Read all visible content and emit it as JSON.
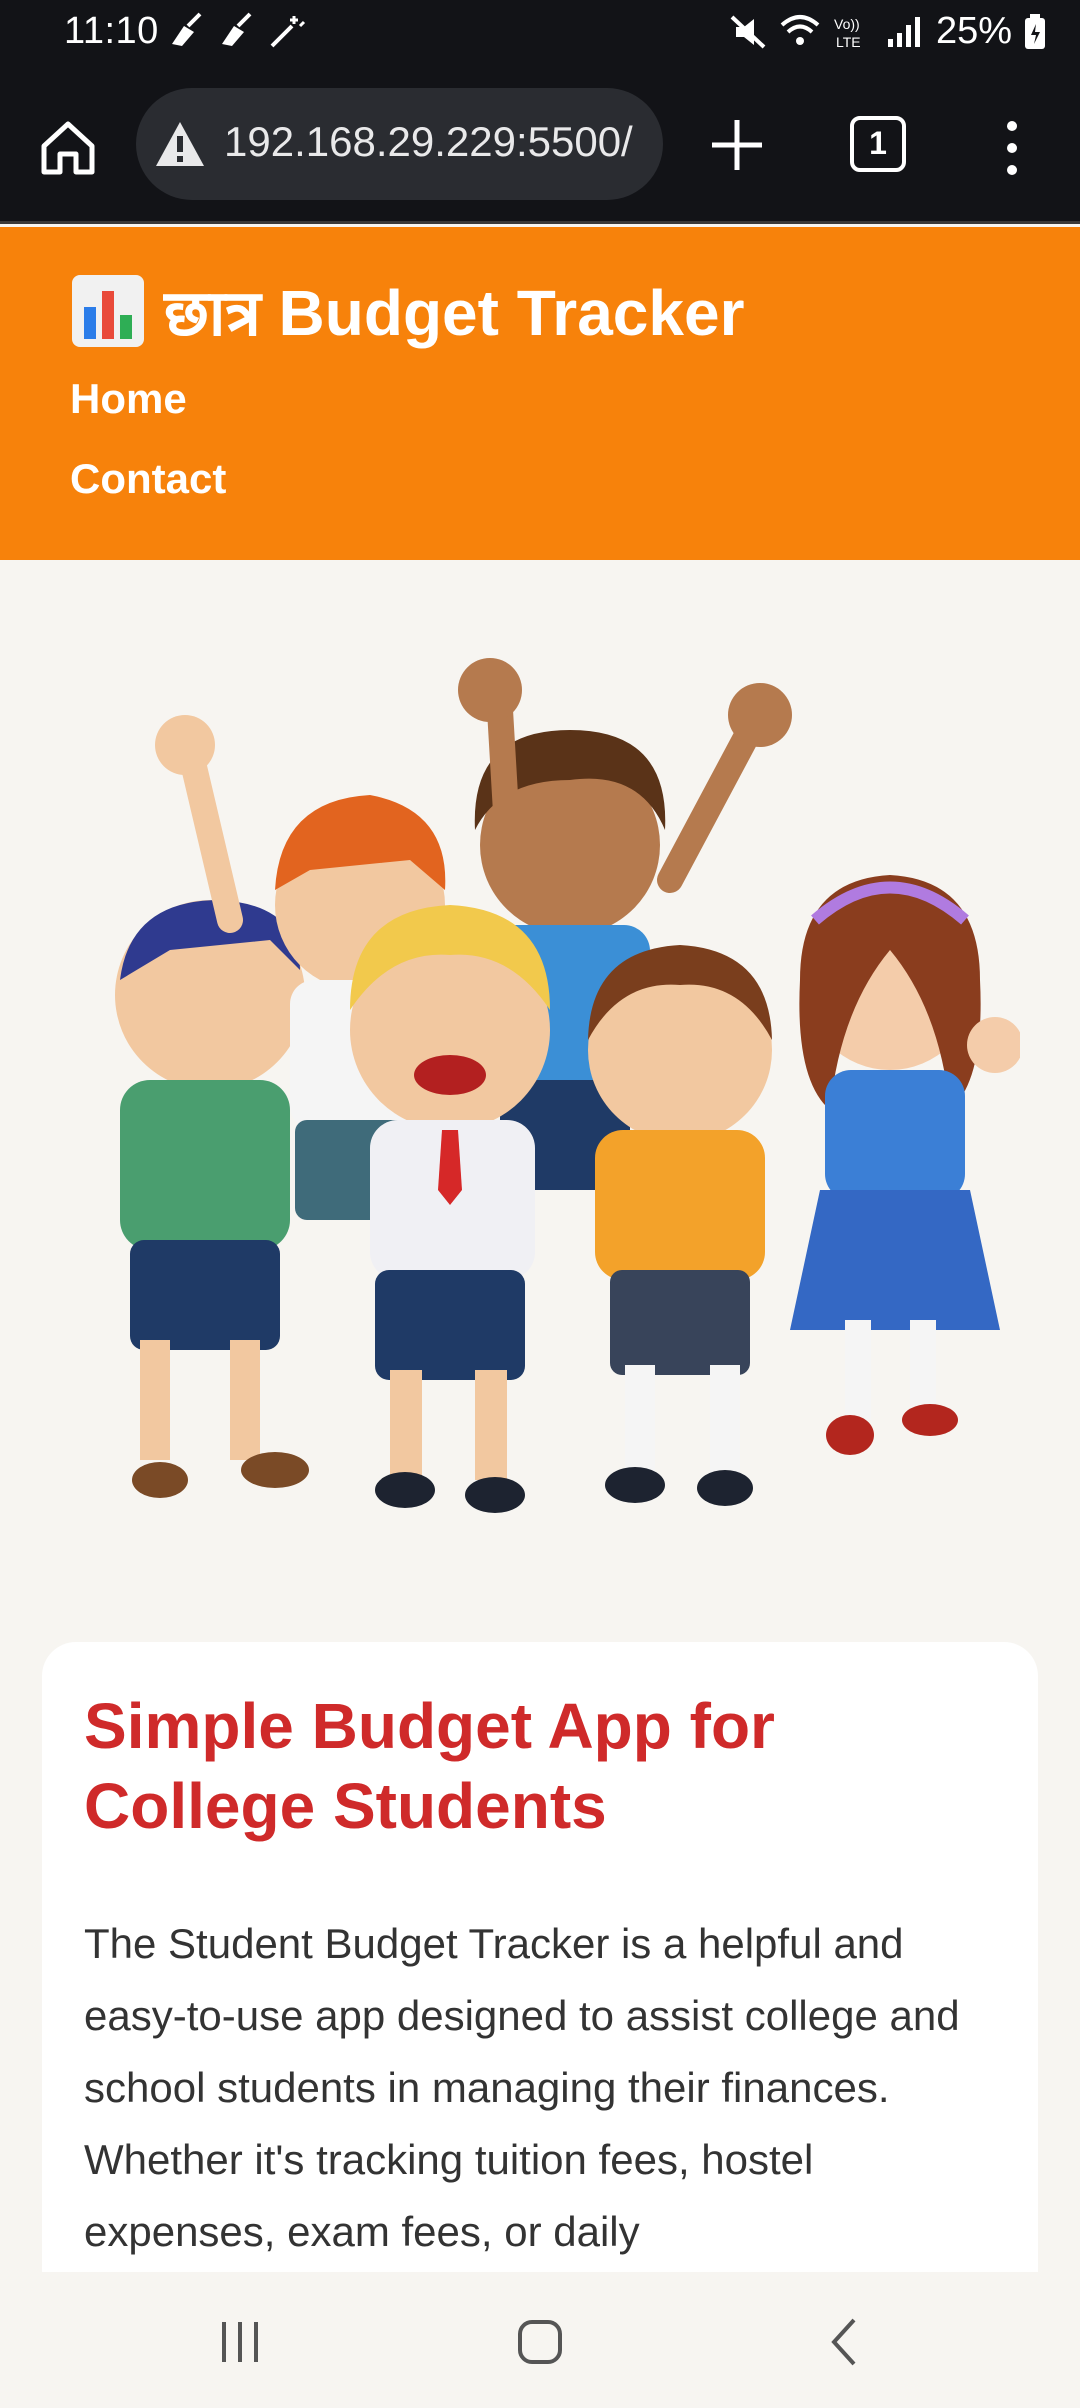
{
  "status_bar": {
    "time": "11:10",
    "battery": "25%"
  },
  "browser": {
    "url": "192.168.29.229:5500/",
    "tab_count": "1"
  },
  "header": {
    "brand_emoji": "📊",
    "title": "छात्र Budget Tracker",
    "nav": [
      "Home",
      "Contact"
    ]
  },
  "card": {
    "heading": "Simple Budget App for College Students",
    "body": "The Student Budget Tracker is a helpful and easy-to-use app designed to assist college and school students in managing their finances. Whether it's tracking tuition fees, hostel expenses, exam fees, or daily"
  },
  "colors": {
    "header_bg": "#f7820b",
    "heading": "#cf2a2a",
    "page_bg": "#f7f5f1"
  },
  "icons": [
    "home-icon",
    "warning-icon",
    "plus-icon",
    "tabs-icon",
    "more-icon",
    "mute-icon",
    "wifi-icon",
    "signal-icon",
    "battery-icon"
  ]
}
